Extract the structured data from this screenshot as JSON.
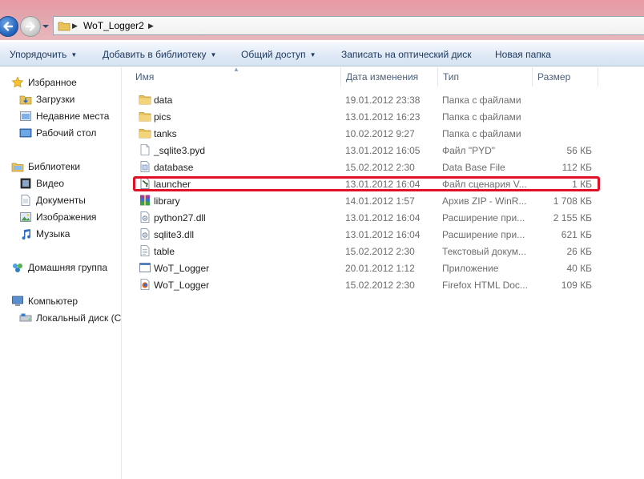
{
  "address": {
    "crumb": "WoT_Logger2"
  },
  "toolbar": {
    "organize": "Упорядочить",
    "add_to_library": "Добавить в библиотеку",
    "share": "Общий доступ",
    "burn": "Записать на оптический диск",
    "new_folder": "Новая папка"
  },
  "nav": {
    "favorites": "Избранное",
    "downloads": "Загрузки",
    "recent": "Недавние места",
    "desktop": "Рабочий стол",
    "libraries": "Библиотеки",
    "video": "Видео",
    "documents": "Документы",
    "images": "Изображения",
    "music": "Музыка",
    "homegroup": "Домашняя группа",
    "computer": "Компьютер",
    "local_disk": "Локальный диск (С"
  },
  "columns": {
    "name": "Имя",
    "date": "Дата изменения",
    "type": "Тип",
    "size": "Размер"
  },
  "files": [
    {
      "name": "data",
      "date": "19.01.2012 23:38",
      "type": "Папка с файлами",
      "size": "",
      "icon": "folder-icon"
    },
    {
      "name": "pics",
      "date": "13.01.2012 16:23",
      "type": "Папка с файлами",
      "size": "",
      "icon": "folder-icon"
    },
    {
      "name": "tanks",
      "date": "10.02.2012 9:27",
      "type": "Папка с файлами",
      "size": "",
      "icon": "folder-icon"
    },
    {
      "name": "_sqlite3.pyd",
      "date": "13.01.2012 16:05",
      "type": "Файл \"PYD\"",
      "size": "56 КБ",
      "icon": "blank-file-icon"
    },
    {
      "name": "database",
      "date": "15.02.2012 2:30",
      "type": "Data Base File",
      "size": "112 КБ",
      "icon": "database-file-icon"
    },
    {
      "name": "launcher",
      "date": "13.01.2012 16:04",
      "type": "Файл сценария V...",
      "size": "1 КБ",
      "icon": "script-file-icon"
    },
    {
      "name": "library",
      "date": "14.01.2012 1:57",
      "type": "Архив ZIP - WinR...",
      "size": "1 708 КБ",
      "icon": "winrar-archive-icon"
    },
    {
      "name": "python27.dll",
      "date": "13.01.2012 16:04",
      "type": "Расширение при...",
      "size": "2 155 КБ",
      "icon": "dll-file-icon"
    },
    {
      "name": "sqlite3.dll",
      "date": "13.01.2012 16:04",
      "type": "Расширение при...",
      "size": "621 КБ",
      "icon": "dll-file-icon"
    },
    {
      "name": "table",
      "date": "15.02.2012 2:30",
      "type": "Текстовый докум...",
      "size": "26 КБ",
      "icon": "text-file-icon"
    },
    {
      "name": "WoT_Logger",
      "date": "20.01.2012 1:12",
      "type": "Приложение",
      "size": "40 КБ",
      "icon": "application-icon"
    },
    {
      "name": "WoT_Logger",
      "date": "15.02.2012 2:30",
      "type": "Firefox HTML Doc...",
      "size": "109 КБ",
      "icon": "firefox-html-icon"
    }
  ],
  "colors": {
    "highlight": "#e01025",
    "folder": "#e8c25a",
    "toolbar_text": "#1e395b"
  }
}
